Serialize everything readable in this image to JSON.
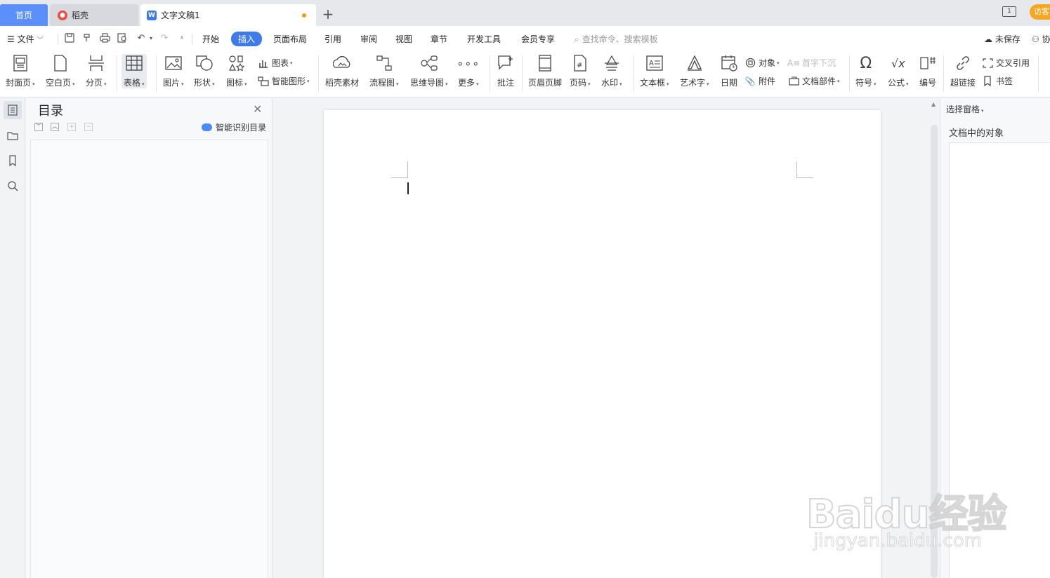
{
  "tabs": {
    "home": "首页",
    "daoke": "稻壳",
    "document": "文字文稿1",
    "window_count": "1",
    "guest": "访客"
  },
  "menu": {
    "file": "文件",
    "items": [
      "开始",
      "插入",
      "页面布局",
      "引用",
      "审阅",
      "视图",
      "章节",
      "开发工具",
      "会员专享"
    ],
    "active": "插入",
    "search_placeholder": "查找命令、搜索模板",
    "unsaved": "未保存",
    "collab": "协"
  },
  "ribbon": {
    "cover_page": "封面页",
    "blank_page": "空白页",
    "page_break": "分页",
    "table": "表格",
    "picture": "图片",
    "shape": "形状",
    "icon": "图标",
    "chart": "图表",
    "smart_shape": "智能图形",
    "daoke_material": "稻壳素材",
    "flowchart": "流程图",
    "mindmap": "思维导图",
    "more": "更多",
    "comment": "批注",
    "header_footer": "页眉页脚",
    "page_number": "页码",
    "watermark": "水印",
    "textbox": "文本框",
    "wordart": "艺术字",
    "date": "日期",
    "object": "对象",
    "attachment": "附件",
    "drop_cap": "首字下沉",
    "doc_parts": "文档部件",
    "symbol": "符号",
    "formula": "公式",
    "numbering": "编号",
    "hyperlink": "超链接",
    "cross_ref": "交叉引用",
    "bookmark": "书签"
  },
  "toc": {
    "title": "目录",
    "smart_recognize": "智能识别目录"
  },
  "right_panel": {
    "title": "选择窗格",
    "objects_label": "文档中的对象"
  },
  "watermark_logo": {
    "main": "Baidu经验",
    "sub": "jingyan.baidu.com"
  },
  "colors": {
    "accent": "#3f7ae9",
    "home_tab": "#5b8ff9",
    "guest_badge": "#f5a623",
    "unsaved_dot": "#f39c12"
  }
}
